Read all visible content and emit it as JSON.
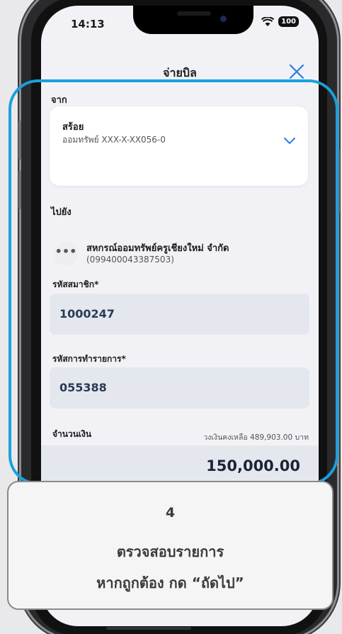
{
  "status": {
    "time": "14:13",
    "battery": "100"
  },
  "header": {
    "title": "จ่ายบิล"
  },
  "from": {
    "label": "จาก",
    "account_name": "สร้อย",
    "account_number": "ออมทรัพย์ XXX-X-XX056-0"
  },
  "to": {
    "label": "ไปยัง",
    "biller_name": "สหกรณ์ออมทรัพย์ครูเชียงใหม่ จำกัด",
    "biller_id": "(099400043387503)"
  },
  "fields": {
    "member_label": "รหัสสมาชิก*",
    "member_value": "1000247",
    "transaction_label": "รหัสการทำรายการ*",
    "transaction_value": "055388",
    "amount_label": "จำนวนเงิน",
    "balance_text": "วงเงินคงเหลือ 489,903.00 บาท",
    "amount_value": "150,000.00"
  },
  "callout": {
    "step": "4",
    "line1": "ตรวจสอบรายการ",
    "line2": "หากถูกต้อง กด “ถัดไป”"
  },
  "colors": {
    "highlight": "#1aa0dc",
    "accent": "#2a7de1"
  }
}
